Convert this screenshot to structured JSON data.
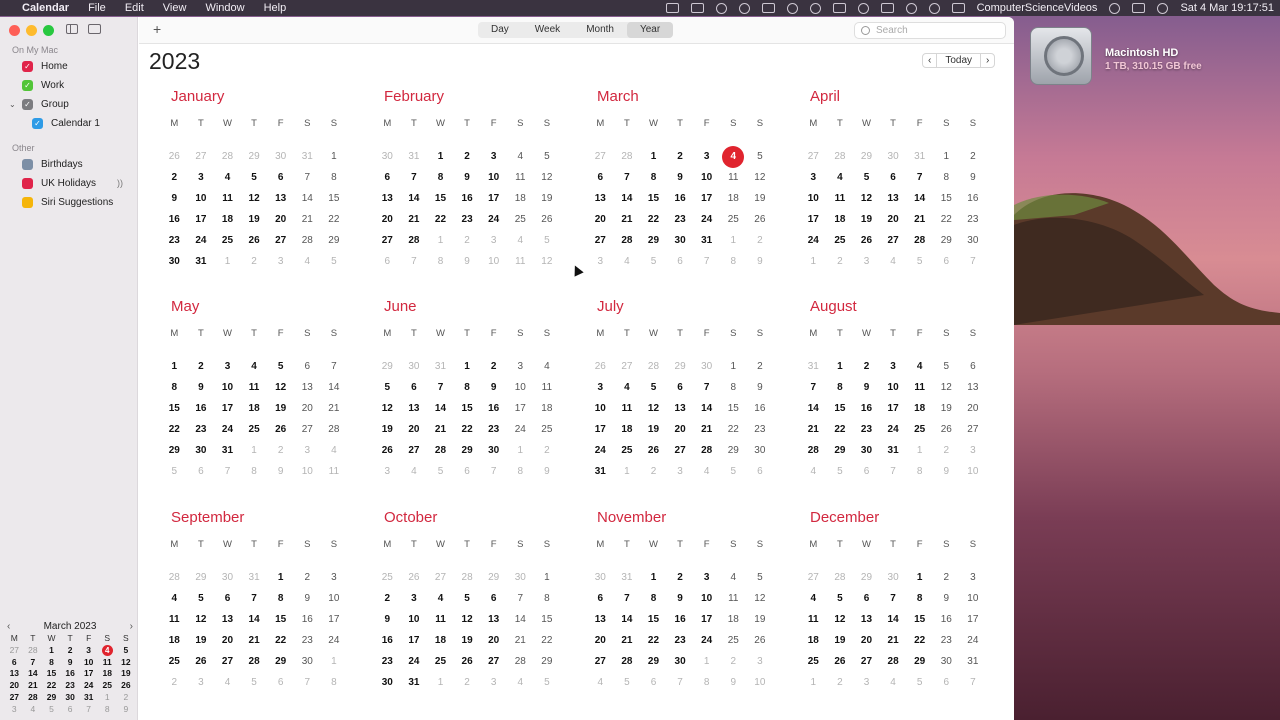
{
  "menubar": {
    "app": "Calendar",
    "menus": [
      "File",
      "Edit",
      "View",
      "Window",
      "Help"
    ],
    "user": "ComputerScienceVideos",
    "datetime": "Sat 4 Mar  19:17:51"
  },
  "desktop": {
    "disk_name": "Macintosh HD",
    "disk_info": "1 TB, 310.15 GB free"
  },
  "toolbar": {
    "add": "+",
    "views": [
      "Day",
      "Week",
      "Month",
      "Year"
    ],
    "active_view": "Year",
    "search_placeholder": "Search"
  },
  "sidebar": {
    "section_mac": "On My Mac",
    "calendars": [
      {
        "label": "Home",
        "color": "#e0244a"
      },
      {
        "label": "Work",
        "color": "#52c538"
      },
      {
        "label": "Group",
        "color": "#7c7c80"
      },
      {
        "label": "Calendar 1",
        "color": "#2e9be6"
      }
    ],
    "section_other": "Other",
    "other": [
      {
        "label": "Birthdays",
        "color": "#7d8fa6"
      },
      {
        "label": "UK Holidays",
        "color": "#e0244a"
      },
      {
        "label": "Siri Suggestions",
        "color": "#f5b50a"
      }
    ]
  },
  "mini_calendar": {
    "title": "March 2023",
    "dow": [
      "M",
      "T",
      "W",
      "T",
      "F",
      "S",
      "S"
    ],
    "weeks": [
      [
        "27",
        "28",
        "1",
        "2",
        "3",
        "4",
        "5"
      ],
      [
        "6",
        "7",
        "8",
        "9",
        "10",
        "11",
        "12"
      ],
      [
        "13",
        "14",
        "15",
        "16",
        "17",
        "18",
        "19"
      ],
      [
        "20",
        "21",
        "22",
        "23",
        "24",
        "25",
        "26"
      ],
      [
        "27",
        "28",
        "29",
        "30",
        "31",
        "1",
        "2"
      ],
      [
        "3",
        "4",
        "5",
        "6",
        "7",
        "8",
        "9"
      ]
    ],
    "leading_out": 2,
    "trailing_out": 9,
    "today": "4"
  },
  "year_view": {
    "year": "2023",
    "nav": {
      "prev": "‹",
      "today": "Today",
      "next": "›"
    },
    "dow": [
      "M",
      "T",
      "W",
      "T",
      "F",
      "S",
      "S"
    ],
    "today": {
      "month": 2,
      "day": 4
    },
    "months": [
      {
        "name": "January",
        "weeks": [
          [
            "26",
            "27",
            "28",
            "29",
            "30",
            "31",
            "1"
          ],
          [
            "2",
            "3",
            "4",
            "5",
            "6",
            "7",
            "8"
          ],
          [
            "9",
            "10",
            "11",
            "12",
            "13",
            "14",
            "15"
          ],
          [
            "16",
            "17",
            "18",
            "19",
            "20",
            "21",
            "22"
          ],
          [
            "23",
            "24",
            "25",
            "26",
            "27",
            "28",
            "29"
          ],
          [
            "30",
            "31",
            "1",
            "2",
            "3",
            "4",
            "5"
          ]
        ]
      },
      {
        "name": "February",
        "weeks": [
          [
            "30",
            "31",
            "1",
            "2",
            "3",
            "4",
            "5"
          ],
          [
            "6",
            "7",
            "8",
            "9",
            "10",
            "11",
            "12"
          ],
          [
            "13",
            "14",
            "15",
            "16",
            "17",
            "18",
            "19"
          ],
          [
            "20",
            "21",
            "22",
            "23",
            "24",
            "25",
            "26"
          ],
          [
            "27",
            "28",
            "1",
            "2",
            "3",
            "4",
            "5"
          ],
          [
            "6",
            "7",
            "8",
            "9",
            "10",
            "11",
            "12"
          ]
        ]
      },
      {
        "name": "March",
        "weeks": [
          [
            "27",
            "28",
            "1",
            "2",
            "3",
            "4",
            "5"
          ],
          [
            "6",
            "7",
            "8",
            "9",
            "10",
            "11",
            "12"
          ],
          [
            "13",
            "14",
            "15",
            "16",
            "17",
            "18",
            "19"
          ],
          [
            "20",
            "21",
            "22",
            "23",
            "24",
            "25",
            "26"
          ],
          [
            "27",
            "28",
            "29",
            "30",
            "31",
            "1",
            "2"
          ],
          [
            "3",
            "4",
            "5",
            "6",
            "7",
            "8",
            "9"
          ]
        ]
      },
      {
        "name": "April",
        "weeks": [
          [
            "27",
            "28",
            "29",
            "30",
            "31",
            "1",
            "2"
          ],
          [
            "3",
            "4",
            "5",
            "6",
            "7",
            "8",
            "9"
          ],
          [
            "10",
            "11",
            "12",
            "13",
            "14",
            "15",
            "16"
          ],
          [
            "17",
            "18",
            "19",
            "20",
            "21",
            "22",
            "23"
          ],
          [
            "24",
            "25",
            "26",
            "27",
            "28",
            "29",
            "30"
          ],
          [
            "1",
            "2",
            "3",
            "4",
            "5",
            "6",
            "7"
          ]
        ]
      },
      {
        "name": "May",
        "weeks": [
          [
            "1",
            "2",
            "3",
            "4",
            "5",
            "6",
            "7"
          ],
          [
            "8",
            "9",
            "10",
            "11",
            "12",
            "13",
            "14"
          ],
          [
            "15",
            "16",
            "17",
            "18",
            "19",
            "20",
            "21"
          ],
          [
            "22",
            "23",
            "24",
            "25",
            "26",
            "27",
            "28"
          ],
          [
            "29",
            "30",
            "31",
            "1",
            "2",
            "3",
            "4"
          ],
          [
            "5",
            "6",
            "7",
            "8",
            "9",
            "10",
            "11"
          ]
        ]
      },
      {
        "name": "June",
        "weeks": [
          [
            "29",
            "30",
            "31",
            "1",
            "2",
            "3",
            "4"
          ],
          [
            "5",
            "6",
            "7",
            "8",
            "9",
            "10",
            "11"
          ],
          [
            "12",
            "13",
            "14",
            "15",
            "16",
            "17",
            "18"
          ],
          [
            "19",
            "20",
            "21",
            "22",
            "23",
            "24",
            "25"
          ],
          [
            "26",
            "27",
            "28",
            "29",
            "30",
            "1",
            "2"
          ],
          [
            "3",
            "4",
            "5",
            "6",
            "7",
            "8",
            "9"
          ]
        ]
      },
      {
        "name": "July",
        "weeks": [
          [
            "26",
            "27",
            "28",
            "29",
            "30",
            "1",
            "2"
          ],
          [
            "3",
            "4",
            "5",
            "6",
            "7",
            "8",
            "9"
          ],
          [
            "10",
            "11",
            "12",
            "13",
            "14",
            "15",
            "16"
          ],
          [
            "17",
            "18",
            "19",
            "20",
            "21",
            "22",
            "23"
          ],
          [
            "24",
            "25",
            "26",
            "27",
            "28",
            "29",
            "30"
          ],
          [
            "31",
            "1",
            "2",
            "3",
            "4",
            "5",
            "6"
          ]
        ]
      },
      {
        "name": "August",
        "weeks": [
          [
            "31",
            "1",
            "2",
            "3",
            "4",
            "5",
            "6"
          ],
          [
            "7",
            "8",
            "9",
            "10",
            "11",
            "12",
            "13"
          ],
          [
            "14",
            "15",
            "16",
            "17",
            "18",
            "19",
            "20"
          ],
          [
            "21",
            "22",
            "23",
            "24",
            "25",
            "26",
            "27"
          ],
          [
            "28",
            "29",
            "30",
            "31",
            "1",
            "2",
            "3"
          ],
          [
            "4",
            "5",
            "6",
            "7",
            "8",
            "9",
            "10"
          ]
        ]
      },
      {
        "name": "September",
        "weeks": [
          [
            "28",
            "29",
            "30",
            "31",
            "1",
            "2",
            "3"
          ],
          [
            "4",
            "5",
            "6",
            "7",
            "8",
            "9",
            "10"
          ],
          [
            "11",
            "12",
            "13",
            "14",
            "15",
            "16",
            "17"
          ],
          [
            "18",
            "19",
            "20",
            "21",
            "22",
            "23",
            "24"
          ],
          [
            "25",
            "26",
            "27",
            "28",
            "29",
            "30",
            "1"
          ],
          [
            "2",
            "3",
            "4",
            "5",
            "6",
            "7",
            "8"
          ]
        ]
      },
      {
        "name": "October",
        "weeks": [
          [
            "25",
            "26",
            "27",
            "28",
            "29",
            "30",
            "1"
          ],
          [
            "2",
            "3",
            "4",
            "5",
            "6",
            "7",
            "8"
          ],
          [
            "9",
            "10",
            "11",
            "12",
            "13",
            "14",
            "15"
          ],
          [
            "16",
            "17",
            "18",
            "19",
            "20",
            "21",
            "22"
          ],
          [
            "23",
            "24",
            "25",
            "26",
            "27",
            "28",
            "29"
          ],
          [
            "30",
            "31",
            "1",
            "2",
            "3",
            "4",
            "5"
          ]
        ]
      },
      {
        "name": "November",
        "weeks": [
          [
            "30",
            "31",
            "1",
            "2",
            "3",
            "4",
            "5"
          ],
          [
            "6",
            "7",
            "8",
            "9",
            "10",
            "11",
            "12"
          ],
          [
            "13",
            "14",
            "15",
            "16",
            "17",
            "18",
            "19"
          ],
          [
            "20",
            "21",
            "22",
            "23",
            "24",
            "25",
            "26"
          ],
          [
            "27",
            "28",
            "29",
            "30",
            "1",
            "2",
            "3"
          ],
          [
            "4",
            "5",
            "6",
            "7",
            "8",
            "9",
            "10"
          ]
        ]
      },
      {
        "name": "December",
        "weeks": [
          [
            "27",
            "28",
            "29",
            "30",
            "1",
            "2",
            "3"
          ],
          [
            "4",
            "5",
            "6",
            "7",
            "8",
            "9",
            "10"
          ],
          [
            "11",
            "12",
            "13",
            "14",
            "15",
            "16",
            "17"
          ],
          [
            "18",
            "19",
            "20",
            "21",
            "22",
            "23",
            "24"
          ],
          [
            "25",
            "26",
            "27",
            "28",
            "29",
            "30",
            "31"
          ],
          [
            "1",
            "2",
            "3",
            "4",
            "5",
            "6",
            "7"
          ]
        ]
      }
    ]
  }
}
